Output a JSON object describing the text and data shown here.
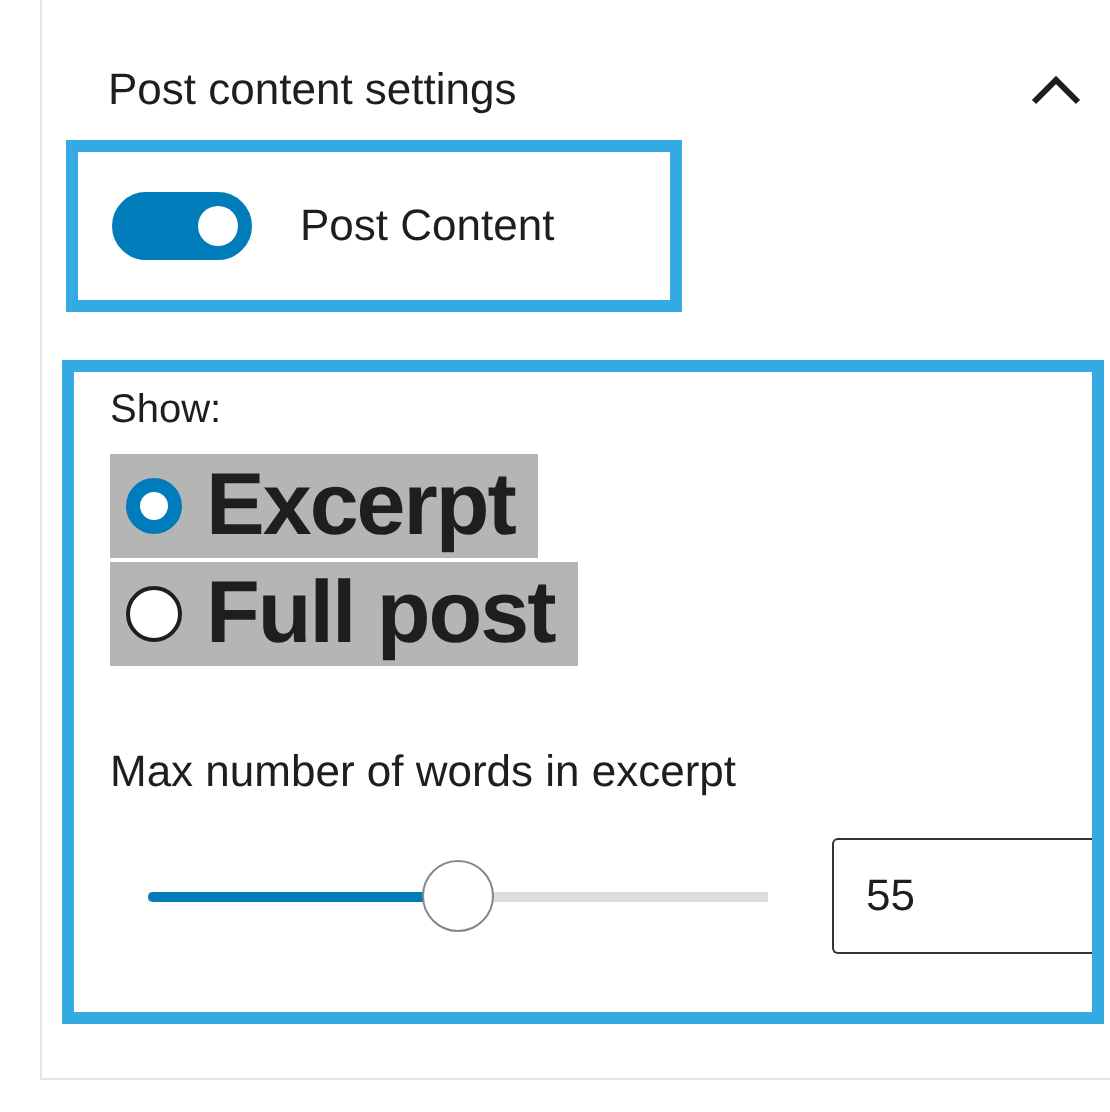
{
  "panel": {
    "title": "Post content settings",
    "expanded": true
  },
  "toggle": {
    "label": "Post Content",
    "on": true
  },
  "show": {
    "label": "Show:",
    "options": [
      {
        "label": "Excerpt",
        "selected": true
      },
      {
        "label": "Full post",
        "selected": false
      }
    ]
  },
  "max_words": {
    "label": "Max number of words in excerpt",
    "level": 0.5,
    "value": "55"
  }
}
